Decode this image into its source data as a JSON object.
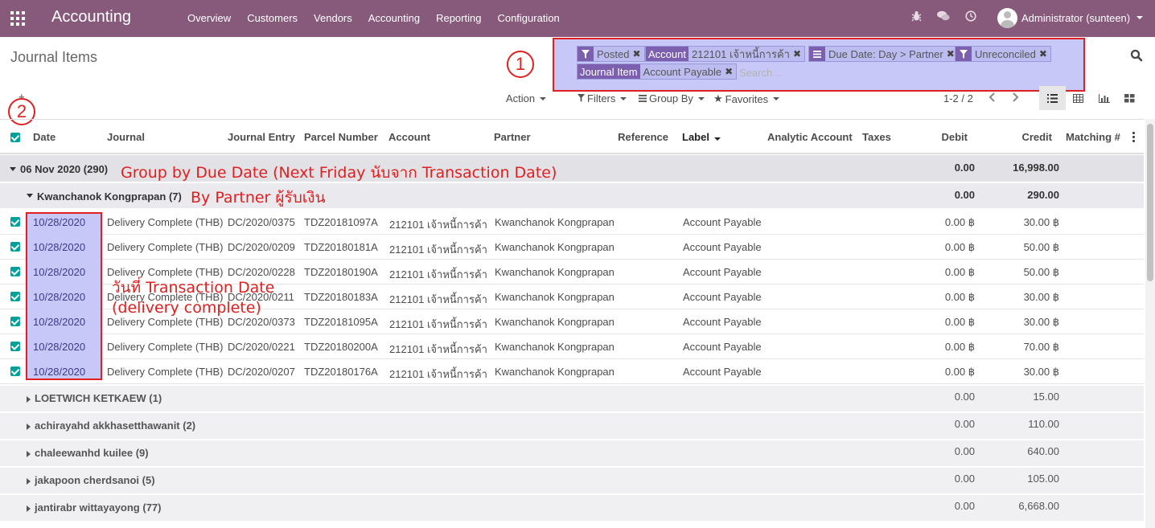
{
  "navbar": {
    "brand": "Accounting",
    "menu": [
      "Overview",
      "Customers",
      "Vendors",
      "Accounting",
      "Reporting",
      "Configuration"
    ],
    "user": "Administrator (sunteen)",
    "bg_color": "#875a7b"
  },
  "control_panel": {
    "title": "Journal Items",
    "search_placeholder": "Search...",
    "facets": [
      {
        "icon": "filter-icon",
        "category": "",
        "value": "Posted"
      },
      {
        "icon": "",
        "category": "Account",
        "value": "212101 เจ้าหนี้การค้า"
      },
      {
        "icon": "group-by-icon",
        "category": "",
        "value": "Due Date: Day > Partner"
      },
      {
        "icon": "filter-icon",
        "category": "",
        "value": "Unreconciled"
      },
      {
        "icon": "",
        "category": "Journal Item",
        "value": "Account Payable"
      }
    ],
    "action_label": "Action",
    "filters_label": "Filters",
    "group_by_label": "Group By",
    "favorites_label": "Favorites",
    "pager": "1-2 / 2"
  },
  "annotations": {
    "marker_1": "1",
    "marker_2": "2",
    "group_note": "Group by Due Date (Next Friday นับจาก Transaction Date)",
    "partner_note": "By Partner ผู้รับเงิน",
    "date_note_1": "วันที่ Transaction Date",
    "date_note_2": "(delivery complete)",
    "accent_color": "#e02020"
  },
  "table": {
    "headers": {
      "date": "Date",
      "journal": "Journal",
      "journal_entry": "Journal Entry",
      "parcel_number": "Parcel Number",
      "account": "Account",
      "partner": "Partner",
      "reference": "Reference",
      "label": "Label",
      "analytic_account": "Analytic Account",
      "taxes": "Taxes",
      "debit": "Debit",
      "credit": "Credit",
      "matching": "Matching #"
    },
    "group1": {
      "label": "06 Nov 2020 (290)",
      "debit": "0.00",
      "credit": "16,998.00"
    },
    "group2": {
      "label": "Kwanchanok Kongprapan (7)",
      "debit": "0.00",
      "credit": "290.00"
    },
    "rows": [
      {
        "date": "10/28/2020",
        "journal": "Delivery Complete (THB)",
        "entry": "DC/2020/0375",
        "parcel": "TDZ20181097A",
        "account": "212101 เจ้าหนี้การค้า",
        "partner": "Kwanchanok Kongprapan",
        "label": "Account Payable",
        "debit": "0.00 ฿",
        "credit": "30.00 ฿"
      },
      {
        "date": "10/28/2020",
        "journal": "Delivery Complete (THB)",
        "entry": "DC/2020/0209",
        "parcel": "TDZ20180181A",
        "account": "212101 เจ้าหนี้การค้า",
        "partner": "Kwanchanok Kongprapan",
        "label": "Account Payable",
        "debit": "0.00 ฿",
        "credit": "50.00 ฿"
      },
      {
        "date": "10/28/2020",
        "journal": "Delivery Complete (THB)",
        "entry": "DC/2020/0228",
        "parcel": "TDZ20180190A",
        "account": "212101 เจ้าหนี้การค้า",
        "partner": "Kwanchanok Kongprapan",
        "label": "Account Payable",
        "debit": "0.00 ฿",
        "credit": "50.00 ฿"
      },
      {
        "date": "10/28/2020",
        "journal": "Delivery Complete (THB)",
        "entry": "DC/2020/0211",
        "parcel": "TDZ20180183A",
        "account": "212101 เจ้าหนี้การค้า",
        "partner": "Kwanchanok Kongprapan",
        "label": "Account Payable",
        "debit": "0.00 ฿",
        "credit": "30.00 ฿"
      },
      {
        "date": "10/28/2020",
        "journal": "Delivery Complete (THB)",
        "entry": "DC/2020/0373",
        "parcel": "TDZ20181095A",
        "account": "212101 เจ้าหนี้การค้า",
        "partner": "Kwanchanok Kongprapan",
        "label": "Account Payable",
        "debit": "0.00 ฿",
        "credit": "30.00 ฿"
      },
      {
        "date": "10/28/2020",
        "journal": "Delivery Complete (THB)",
        "entry": "DC/2020/0221",
        "parcel": "TDZ20180200A",
        "account": "212101 เจ้าหนี้การค้า",
        "partner": "Kwanchanok Kongprapan",
        "label": "Account Payable",
        "debit": "0.00 ฿",
        "credit": "70.00 ฿"
      },
      {
        "date": "10/28/2020",
        "journal": "Delivery Complete (THB)",
        "entry": "DC/2020/0207",
        "parcel": "TDZ20180176A",
        "account": "212101 เจ้าหนี้การค้า",
        "partner": "Kwanchanok Kongprapan",
        "label": "Account Payable",
        "debit": "0.00 ฿",
        "credit": "30.00 ฿"
      }
    ],
    "subgroups": [
      {
        "label": "LOETWICH KETKAEW (1)",
        "debit": "0.00",
        "credit": "15.00"
      },
      {
        "label": "achirayahd akkhasetthawanit (2)",
        "debit": "0.00",
        "credit": "110.00"
      },
      {
        "label": "chaleewanhd kuilee (9)",
        "debit": "0.00",
        "credit": "640.00"
      },
      {
        "label": "jakapoon cherdsanoi (5)",
        "debit": "0.00",
        "credit": "105.00"
      },
      {
        "label": "jantirabr wittayayong (77)",
        "debit": "0.00",
        "credit": "6,668.00"
      }
    ]
  }
}
